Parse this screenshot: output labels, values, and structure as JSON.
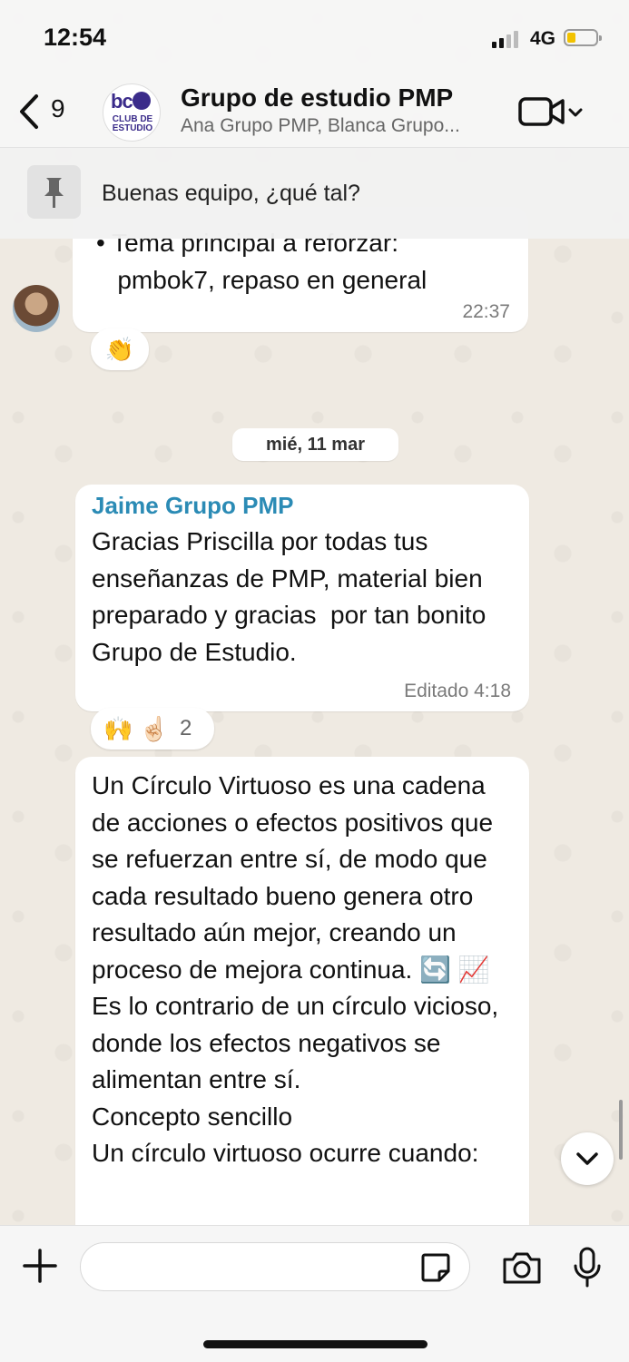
{
  "status_bar": {
    "time": "12:54",
    "network": "4G"
  },
  "header": {
    "back_count": "9",
    "title": "Grupo de estudio PMP",
    "subtitle": "Ana Grupo PMP, Blanca Grupo...",
    "avatar_logo_text": "bc",
    "avatar_caption": "CLUB DE ESTUDIO"
  },
  "pinned": {
    "text": "Buenas equipo, ¿qué tal?"
  },
  "messages": [
    {
      "text": "• Tema principal a reforzar:\n   pmbok7, repaso en general",
      "time": "22:37",
      "reaction": "👏"
    },
    {
      "text": "Gracias Priscilla por todas tus enseñanzas de PMP, material bien preparado y gracias  por tan bonito Grupo de Estudio.",
      "time": "Editado 4:18",
      "reactions": "🙌 ☝🏻",
      "reaction_count": "2",
      "sender": "Jaime Grupo PMP"
    },
    {
      "text": "Un Círculo Virtuoso es una cadena de acciones o efectos positivos que se refuerzan entre sí, de modo que cada resultado bueno genera otro resultado aún mejor, creando un proceso de mejora continua. 🔄 📈\nEs lo contrario de un círculo vicioso, donde los efectos negativos se alimentan entre sí.\nConcepto sencillo\nUn círculo virtuoso ocurre cuando:"
    }
  ],
  "date_separator": "mié, 11 mar",
  "input": {
    "placeholder": ""
  },
  "colors": {
    "sender_name": "#2b8bb5",
    "brand": "#3a2b8a",
    "battery": "#f2c200"
  },
  "icons": [
    "back-chevron-icon",
    "video-call-icon",
    "chevron-down-icon",
    "pin-icon",
    "plus-icon",
    "sticker-icon",
    "camera-icon",
    "mic-icon",
    "scroll-down-icon"
  ]
}
